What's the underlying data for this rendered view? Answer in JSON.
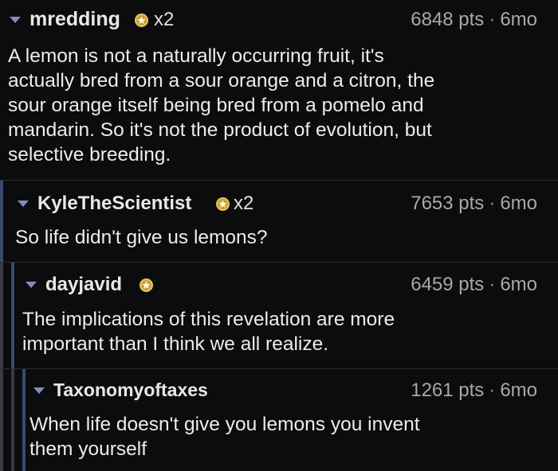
{
  "comments": [
    {
      "username": "mredding",
      "award_icon": "award-icon",
      "award_count": "x2",
      "points": "6848 pts",
      "separator": "·",
      "age": "6mo",
      "text": "A lemon is not a naturally occurring fruit, it's\nactually bred from a sour orange and a citron, the\nsour orange itself being bred from a pomelo and\nmandarin. So it's not the product of evolution, but\nselective breeding."
    },
    {
      "username": "KyleTheScientist",
      "award_icon": "award-icon",
      "award_count": "x2",
      "points": "7653 pts",
      "separator": "·",
      "age": "6mo",
      "text": "So life didn't give us lemons?"
    },
    {
      "username": "dayjavid",
      "award_icon": "award-icon",
      "points": "6459 pts",
      "separator": "·",
      "age": "6mo",
      "text": "The implications of this revelation are more\nimportant than I think we all realize."
    },
    {
      "username": "Taxonomyoftaxes",
      "points": "1261 pts",
      "separator": "·",
      "age": "6mo",
      "text": "When life doesn't give you lemons you invent\nthem yourself"
    }
  ]
}
